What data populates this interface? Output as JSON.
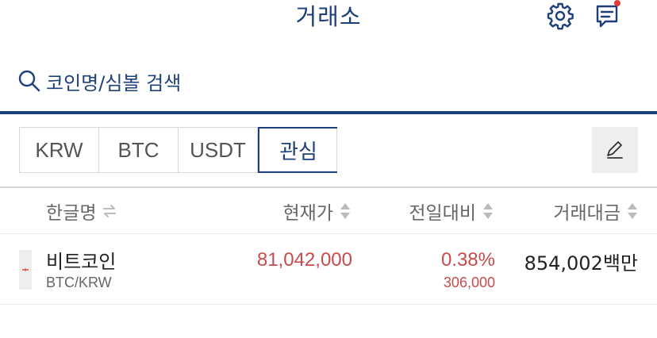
{
  "header": {
    "title": "거래소",
    "settings_icon": "gear-icon",
    "chat_icon": "chat-icon"
  },
  "search": {
    "placeholder": "코인명/심볼 검색",
    "icon": "search-icon"
  },
  "tabs": [
    {
      "label": "KRW",
      "selected": false
    },
    {
      "label": "BTC",
      "selected": false
    },
    {
      "label": "USDT",
      "selected": false
    },
    {
      "label": "관심",
      "selected": true
    }
  ],
  "edit": {
    "icon": "pencil-icon"
  },
  "columns": {
    "name": "한글명",
    "price": "현재가",
    "change": "전일대비",
    "volume": "거래대금"
  },
  "rows": [
    {
      "name": "비트코인",
      "symbol": "BTC/KRW",
      "price": "81,042,000",
      "change_rate": "0.38%",
      "change_amount": "306,000",
      "volume": "854,002백만"
    }
  ],
  "colors": {
    "accent": "#1d3f7a",
    "rise": "#c84a4a",
    "notification": "#e03a3a"
  }
}
